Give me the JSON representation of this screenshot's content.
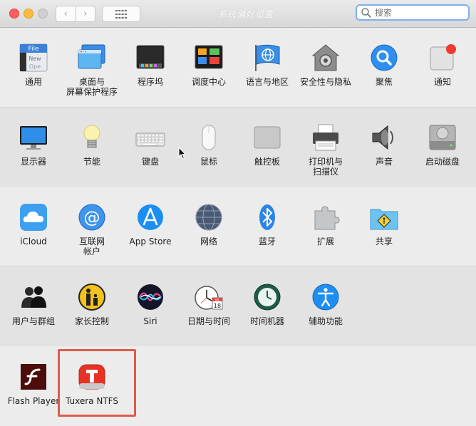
{
  "window": {
    "title": "系统偏好设置"
  },
  "toolbar": {
    "back_glyph": "‹",
    "forward_glyph": "›",
    "search_placeholder": "搜索"
  },
  "rows": [
    [
      {
        "id": "general",
        "icon": "general-icon",
        "label": "通用",
        "icon_text_top": "File",
        "icon_text_mid": "New",
        "icon_text_bot": "Ope"
      },
      {
        "id": "desktop-screensaver",
        "icon": "desktop-screensaver-icon",
        "label1": "桌面与",
        "label2": "屏幕保护程序"
      },
      {
        "id": "dock",
        "icon": "dock-icon",
        "label": "程序坞"
      },
      {
        "id": "mission-control",
        "icon": "mission-control-icon",
        "label": "调度中心"
      },
      {
        "id": "language-region",
        "icon": "globe-flag-icon",
        "label": "语言与地区"
      },
      {
        "id": "security-privacy",
        "icon": "house-lock-icon",
        "label": "安全性与隐私"
      },
      {
        "id": "spotlight",
        "icon": "spotlight-magnifier-icon",
        "label": "聚焦"
      },
      {
        "id": "notifications",
        "icon": "notifications-icon",
        "label": "通知"
      }
    ],
    [
      {
        "id": "displays",
        "icon": "monitor-icon",
        "label": "显示器"
      },
      {
        "id": "energy-saver",
        "icon": "lightbulb-icon",
        "label": "节能"
      },
      {
        "id": "keyboard",
        "icon": "keyboard-icon",
        "label": "键盘"
      },
      {
        "id": "mouse",
        "icon": "mouse-icon",
        "label": "鼠标"
      },
      {
        "id": "trackpad",
        "icon": "trackpad-icon",
        "label": "触控板"
      },
      {
        "id": "printers-scanners",
        "icon": "printer-icon",
        "label1": "打印机与",
        "label2": "扫描仪"
      },
      {
        "id": "sound",
        "icon": "speaker-icon",
        "label": "声音"
      },
      {
        "id": "startup-disk",
        "icon": "hard-disk-icon",
        "label": "启动磁盘"
      }
    ],
    [
      {
        "id": "icloud",
        "icon": "icloud-icon",
        "label": "iCloud"
      },
      {
        "id": "internet-accounts",
        "icon": "at-sign-icon",
        "label1": "互联网",
        "label2": "帐户"
      },
      {
        "id": "app-store",
        "icon": "app-store-icon",
        "label": "App Store"
      },
      {
        "id": "network",
        "icon": "network-globe-icon",
        "label": "网络"
      },
      {
        "id": "bluetooth",
        "icon": "bluetooth-icon",
        "label": "蓝牙"
      },
      {
        "id": "extensions",
        "icon": "puzzle-piece-icon",
        "label": "扩展"
      },
      {
        "id": "sharing",
        "icon": "sharing-folder-icon",
        "label": "共享"
      }
    ],
    [
      {
        "id": "users-groups",
        "icon": "users-icon",
        "label": "用户与群组"
      },
      {
        "id": "parental-controls",
        "icon": "parental-controls-icon",
        "label": "家长控制"
      },
      {
        "id": "siri",
        "icon": "siri-icon",
        "label": "Siri"
      },
      {
        "id": "date-time",
        "icon": "clock-calendar-icon",
        "label": "日期与时间",
        "calendar_month": "JUL",
        "calendar_day": "18"
      },
      {
        "id": "time-machine",
        "icon": "time-machine-icon",
        "label": "时间机器"
      },
      {
        "id": "accessibility",
        "icon": "accessibility-icon",
        "label": "辅助功能"
      }
    ],
    [
      {
        "id": "flash-player",
        "icon": "flash-player-icon",
        "label": "Flash Player"
      },
      {
        "id": "tuxera-ntfs",
        "icon": "tuxera-ntfs-icon",
        "label": "Tuxera NTFS",
        "highlighted": true
      }
    ]
  ]
}
